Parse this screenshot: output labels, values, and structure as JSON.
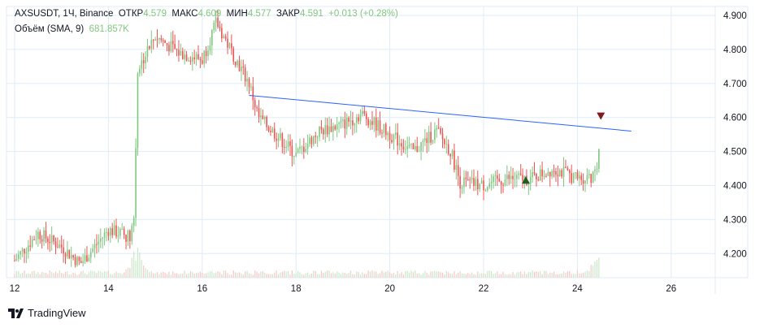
{
  "header": {
    "symbol": "AXSUSDT, 1Ч, Binance",
    "open_label": "ОТКР",
    "open": "4.579",
    "high_label": "МАКС",
    "high": "4.609",
    "low_label": "МИН",
    "low": "4.577",
    "close_label": "ЗАКР",
    "close": "4.591",
    "change": "+0.013 (+0.28%)",
    "volume_label": "Объём (SMA, 9)",
    "volume": "681.857K"
  },
  "branding": {
    "logo": "TradingView"
  },
  "colors": {
    "up": "#26a69a",
    "up_candle": "#7fc77f",
    "down": "#ef5350",
    "grid": "#e0ebf7",
    "trend": "#2962ff",
    "axis_text": "#131722"
  },
  "chart_data": {
    "type": "candlestick",
    "title": "AXSUSDT, 1Ч, Binance",
    "xlabel": "",
    "ylabel": "",
    "x_ticks": [
      "12",
      "14",
      "16",
      "18",
      "20",
      "22",
      "24",
      "26"
    ],
    "y_ticks": [
      "4.900",
      "4.800",
      "4.700",
      "4.600",
      "4.500",
      "4.400",
      "4.300",
      "4.200"
    ],
    "xlim": [
      11.9,
      26.9
    ],
    "ylim": [
      4.12,
      4.92
    ],
    "price_path": [
      [
        12.0,
        4.18
      ],
      [
        12.5,
        4.26
      ],
      [
        13.0,
        4.22
      ],
      [
        13.4,
        4.17
      ],
      [
        14.0,
        4.27
      ],
      [
        14.45,
        4.25
      ],
      [
        14.55,
        4.31
      ],
      [
        14.62,
        4.74
      ],
      [
        15.0,
        4.84
      ],
      [
        15.5,
        4.79
      ],
      [
        16.0,
        4.77
      ],
      [
        16.3,
        4.88
      ],
      [
        16.6,
        4.8
      ],
      [
        17.0,
        4.7
      ],
      [
        17.2,
        4.6
      ],
      [
        17.5,
        4.56
      ],
      [
        18.0,
        4.49
      ],
      [
        18.5,
        4.56
      ],
      [
        19.0,
        4.58
      ],
      [
        19.4,
        4.61
      ],
      [
        20.0,
        4.55
      ],
      [
        20.5,
        4.5
      ],
      [
        21.0,
        4.56
      ],
      [
        21.3,
        4.5
      ],
      [
        21.5,
        4.41
      ],
      [
        22.0,
        4.4
      ],
      [
        22.5,
        4.42
      ],
      [
        23.0,
        4.42
      ],
      [
        23.5,
        4.45
      ],
      [
        24.0,
        4.42
      ],
      [
        24.4,
        4.43
      ],
      [
        24.5,
        4.591
      ]
    ],
    "trendline": [
      [
        17.0,
        4.665
      ],
      [
        25.15,
        4.56
      ]
    ],
    "markers": [
      {
        "type": "buy",
        "x": 22.9,
        "y": 4.415
      },
      {
        "type": "sell",
        "x": 24.5,
        "y": 4.605
      }
    ],
    "volume_spikes": [
      [
        14.6,
        0.9
      ],
      [
        24.5,
        1.0
      ]
    ]
  }
}
